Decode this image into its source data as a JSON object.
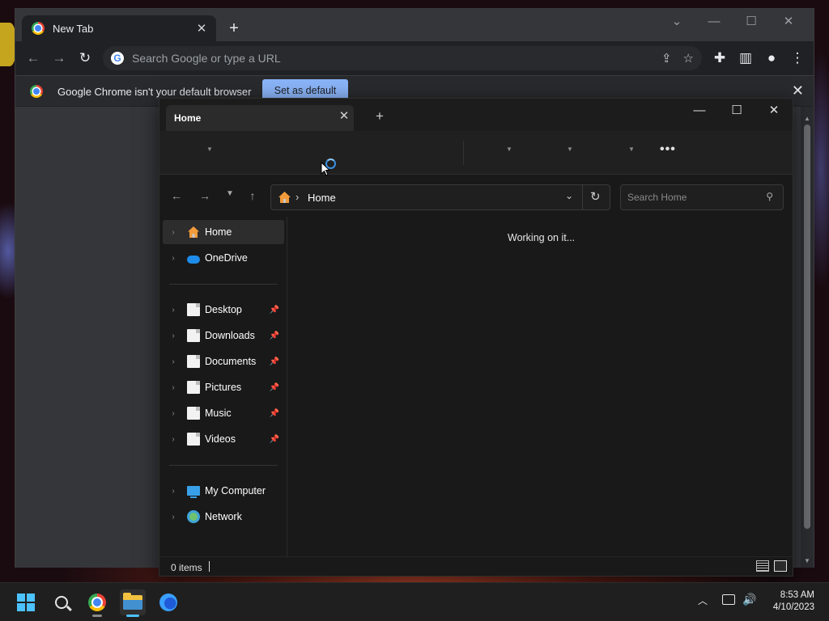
{
  "browser": {
    "tab_title": "New Tab",
    "new_tab": "+",
    "omnibox_placeholder": "Search Google or type a URL",
    "infobar": {
      "message": "Google Chrome isn't your default browser",
      "button": "Set as default"
    }
  },
  "explorer": {
    "tab_title": "Home",
    "breadcrumb": [
      "Home"
    ],
    "search_placeholder": "Search Home",
    "status_message": "Working on it...",
    "item_count": "0 items",
    "sidebar": {
      "top": [
        {
          "label": "Home",
          "icon": "home-icon",
          "active": true
        },
        {
          "label": "OneDrive",
          "icon": "cloud-icon",
          "active": false
        }
      ],
      "quick_access": [
        {
          "label": "Desktop",
          "icon": "file-icon",
          "pinned": true
        },
        {
          "label": "Downloads",
          "icon": "file-icon",
          "pinned": true
        },
        {
          "label": "Documents",
          "icon": "file-icon",
          "pinned": true
        },
        {
          "label": "Pictures",
          "icon": "file-icon",
          "pinned": true
        },
        {
          "label": "Music",
          "icon": "file-icon",
          "pinned": true
        },
        {
          "label": "Videos",
          "icon": "file-icon",
          "pinned": true
        }
      ],
      "devices": [
        {
          "label": "My Computer",
          "icon": "computer-icon"
        },
        {
          "label": "Network",
          "icon": "network-icon"
        }
      ]
    }
  },
  "taskbar": {
    "apps": [
      "start-icon",
      "search-icon",
      "chrome-icon",
      "file-explorer-icon",
      "firefox-icon"
    ],
    "active_app": "file-explorer-icon",
    "time": "8:53 AM",
    "date": "4/10/2023"
  },
  "colors": {
    "accent": "#4cc2ff",
    "set_default_button": "#8ab4f8",
    "explorer_bg": "#191919"
  }
}
